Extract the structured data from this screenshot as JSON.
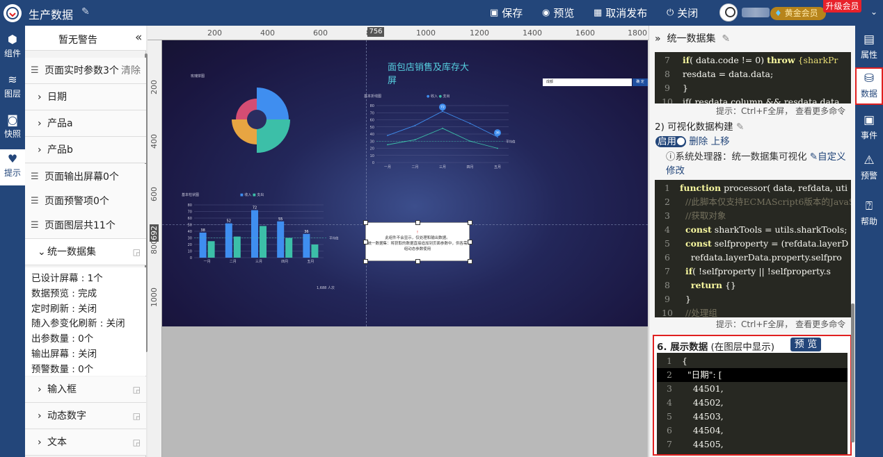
{
  "app": {
    "title": "生产数据",
    "save": "保存",
    "preview": "预览",
    "unpublish": "取消发布",
    "close": "关闭",
    "member": "黄金会员",
    "upgrade": "升级会员"
  },
  "left_rail": [
    {
      "label": "组件"
    },
    {
      "label": "图层"
    },
    {
      "label": "快照"
    },
    {
      "label": "提示"
    }
  ],
  "left_panel": {
    "header": "暂无警告",
    "params_row": "页面实时参数3个",
    "clear": "清除",
    "params": [
      "日期",
      "产品a",
      "产品b"
    ],
    "output_screens": "页面输出屏幕0个",
    "alerts": "页面预警项0个",
    "layers": "页面图层共11个",
    "dataset": "统一数据集",
    "details": [
      "已设计屏幕 : 1个",
      "数据预览 : 完成",
      "定时刷新 : 关闭",
      "随入参变化刷新 : 关闭",
      "出参数量 : 0个",
      "输出屏幕 : 关闭",
      "预警数量 : 0个"
    ],
    "components": [
      "输入框",
      "动态数字",
      "文本"
    ]
  },
  "ruler": {
    "h": [
      "200",
      "400",
      "600",
      "800",
      "1000",
      "1200",
      "1400",
      "1600",
      "1800"
    ],
    "v": [
      "200",
      "400",
      "600",
      "800",
      "1000"
    ],
    "hmark": "756",
    "vmark": "692"
  },
  "canvas": {
    "title": "面包店销售及库存大屏",
    "pie_label": "玫瑰饼图",
    "city": "成都",
    "city_btn": "确 定",
    "line_title": "基本折线图",
    "bar_title": "基本柱状图",
    "legend": [
      "收入",
      "支出"
    ],
    "months": [
      "一月",
      "二月",
      "三月",
      "四月",
      "五月"
    ],
    "y_ticks": [
      "80",
      "70",
      "60",
      "50",
      "40",
      "30",
      "20",
      "10",
      "0"
    ],
    "avg_label": "平均值",
    "bar_labels": [
      "38",
      "52",
      "72",
      "55",
      "36"
    ],
    "line_pins": [
      "72",
      "36"
    ],
    "visitors": "1,688 人次",
    "popup_l1": "此组件不会显示，仅处理和输出数据。",
    "popup_l2": "统一数据集：将获取的数据直接追加到页面参数中，供各需组动态参数使用",
    "popup_icon": "!"
  },
  "chart_data": [
    {
      "type": "line",
      "title": "基本折线图",
      "categories": [
        "一月",
        "二月",
        "三月",
        "四月",
        "五月"
      ],
      "ylim": [
        0,
        80
      ],
      "series": [
        {
          "name": "收入",
          "values": [
            38,
            52,
            72,
            55,
            36
          ]
        },
        {
          "name": "支出",
          "values": [
            25,
            32,
            48,
            30,
            20
          ]
        }
      ]
    },
    {
      "type": "bar",
      "title": "基本柱状图",
      "categories": [
        "一月",
        "二月",
        "三月",
        "四月",
        "五月"
      ],
      "ylim": [
        0,
        80
      ],
      "series": [
        {
          "name": "收入",
          "values": [
            38,
            52,
            72,
            55,
            36
          ]
        },
        {
          "name": "支出",
          "values": [
            25,
            32,
            48,
            30,
            20
          ]
        }
      ]
    }
  ],
  "right_panel": {
    "header": "统一数据集",
    "code1": [
      {
        "n": "7",
        "t": "if( data.code != 0) throw {sharkPr"
      },
      {
        "n": "8",
        "t": "resdata = data.data;"
      },
      {
        "n": "9",
        "t": "}"
      },
      {
        "n": "10",
        "t": "if( resdata.column && resdata.data"
      }
    ],
    "hint": "提示：Ctrl+F全屏， 查看更多命令 。",
    "step2": "2)  可视化数据构建",
    "enabled": "启用",
    "delete": "删除",
    "moveup": "上移",
    "sys_proc": "ⓘ系统处理器：统一数据集可视化",
    "custom": "自定义",
    "modify": "修改",
    "code2": [
      {
        "n": "1",
        "t": "function processor( data, refdata, uti"
      },
      {
        "n": "2",
        "t": "//此脚本仅支持ECMAScript6版本的JavaS"
      },
      {
        "n": "3",
        "t": "//获取对象"
      },
      {
        "n": "4",
        "t": "const sharkTools = utils.sharkTools;"
      },
      {
        "n": "5",
        "t": "const selfproperty = (refdata.layerD"
      },
      {
        "n": "6",
        "t": "refdata.layerData.property.selfpro"
      },
      {
        "n": "7",
        "t": "if( !selfproperty || !selfproperty.s"
      },
      {
        "n": "8",
        "t": "return {}"
      },
      {
        "n": "9",
        "t": "}"
      },
      {
        "n": "10",
        "t": "//处理组"
      }
    ],
    "sec6_title": "6. 展示数据",
    "sec6_sub": "(在图层中显示)",
    "preview_btn": "预 览",
    "code3": [
      {
        "n": "1",
        "t": "{"
      },
      {
        "n": "2",
        "t": "\"日期\": ["
      },
      {
        "n": "3",
        "t": "44501,"
      },
      {
        "n": "4",
        "t": "44502,"
      },
      {
        "n": "5",
        "t": "44503,"
      },
      {
        "n": "6",
        "t": "44504,"
      },
      {
        "n": "7",
        "t": "44505,"
      }
    ]
  },
  "right_rail": [
    {
      "label": "属性"
    },
    {
      "label": "数据"
    },
    {
      "label": "事件"
    },
    {
      "label": "预警"
    },
    {
      "label": "帮助"
    }
  ]
}
